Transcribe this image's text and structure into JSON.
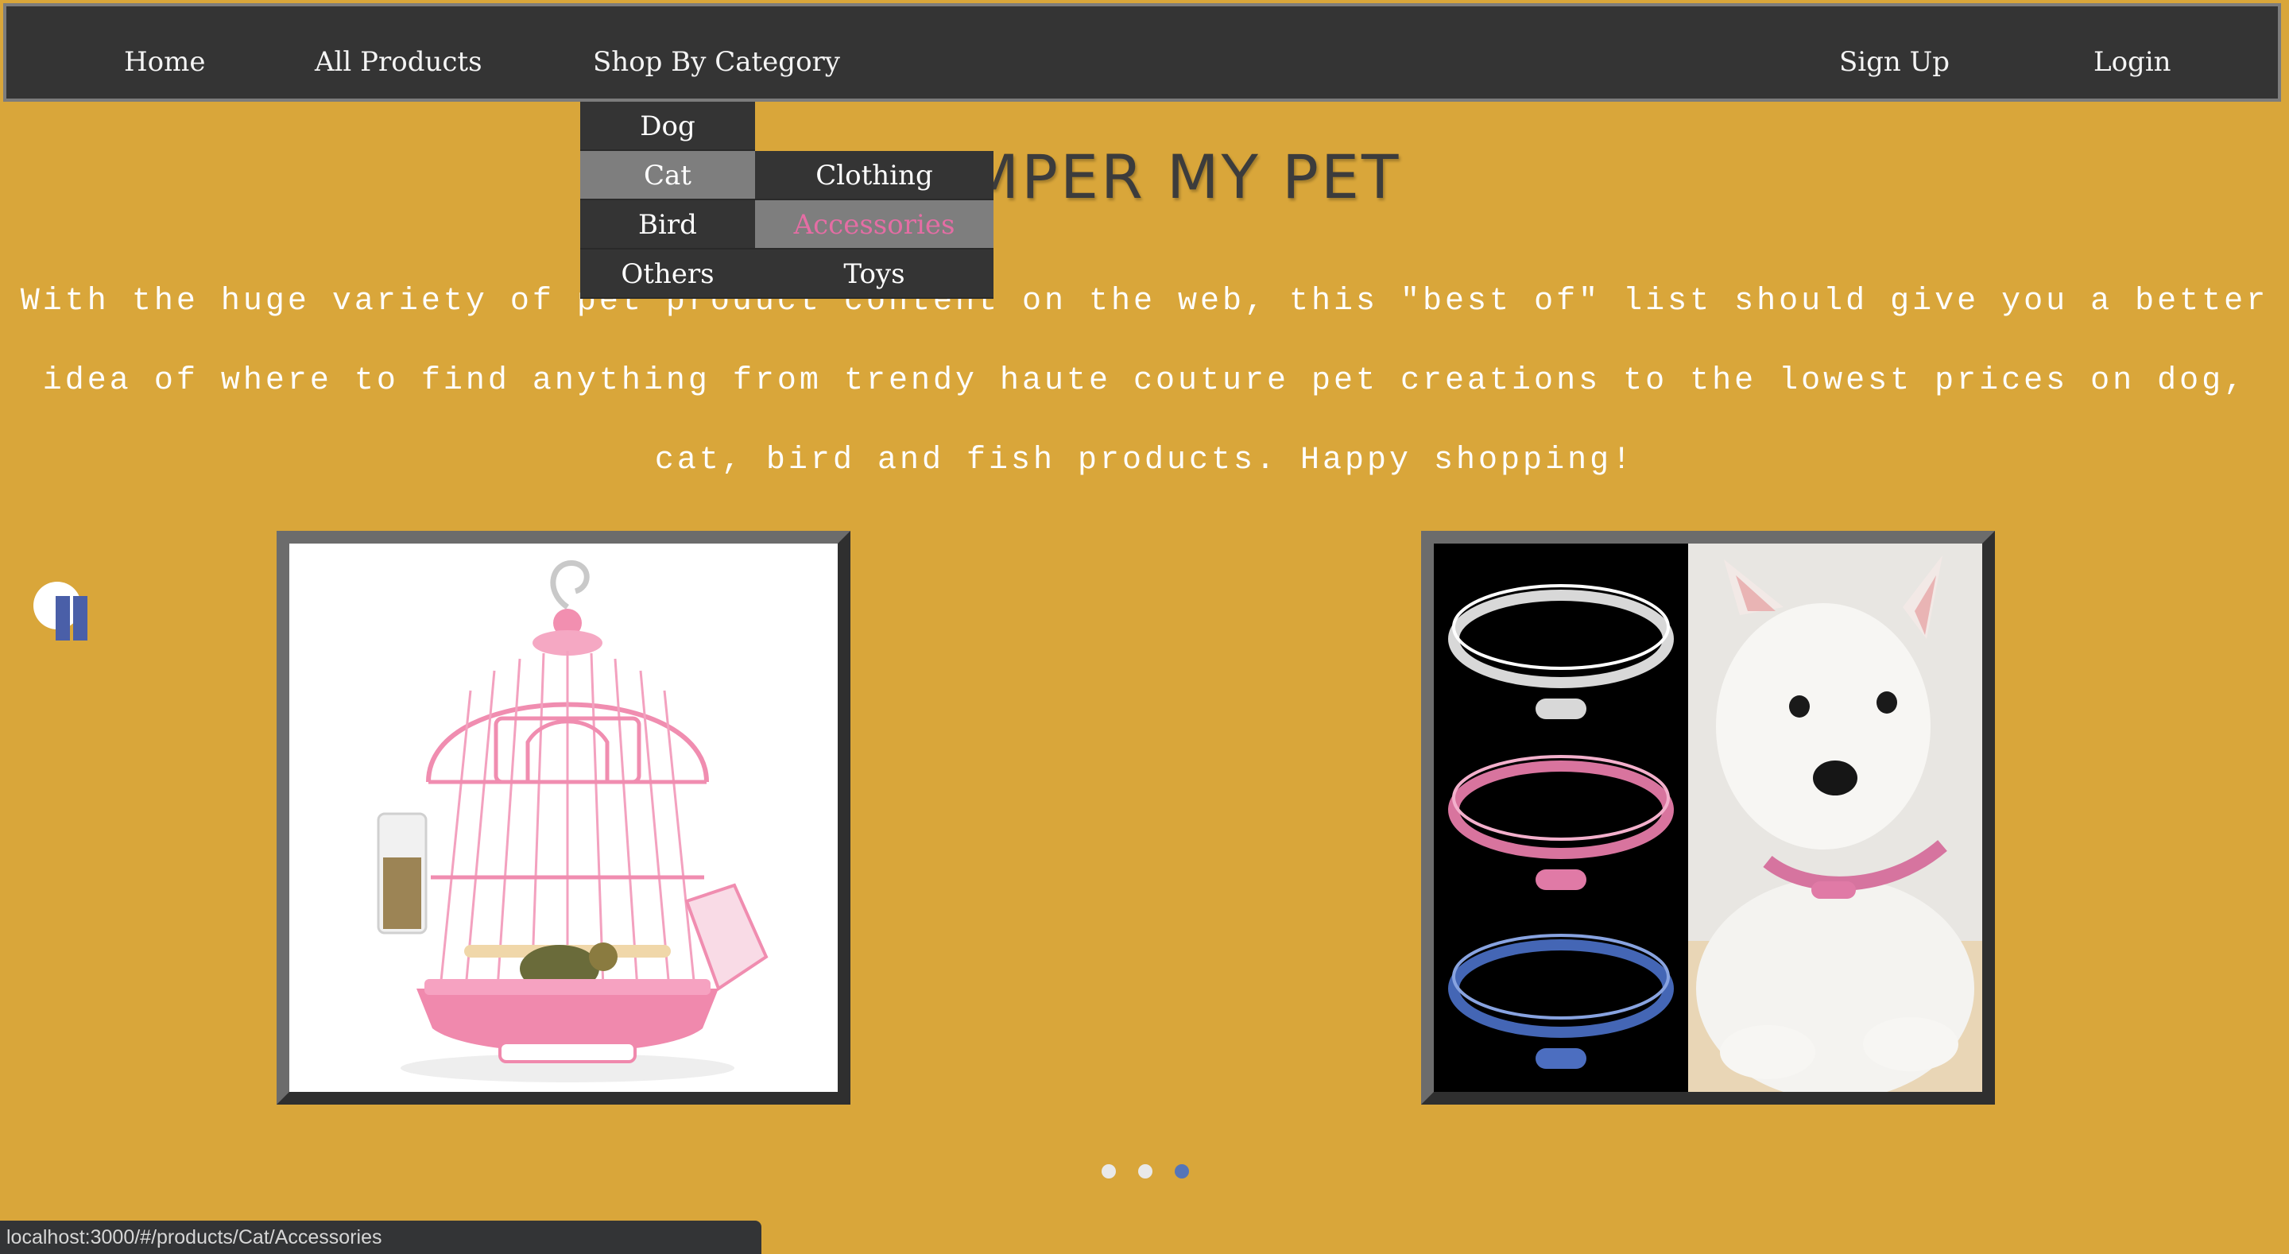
{
  "nav": {
    "home": "Home",
    "all_products": "All Products",
    "shop_by_category": "Shop By Category",
    "sign_up": "Sign Up",
    "login": "Login"
  },
  "dropdown": {
    "categories": [
      "Dog",
      "Cat",
      "Bird",
      "Others"
    ],
    "active_category": "Cat",
    "subcategories": [
      "Clothing",
      "Accessories",
      "Toys"
    ],
    "active_subcategory": "Accessories"
  },
  "hero": {
    "title": "PAMPER MY PET",
    "intro": "With the huge variety of pet product content on the web, this \"best of\" list should give you a better idea of where to find anything from trendy haute couture pet creations to the lowest prices on dog, cat, bird and fish products. Happy shopping!"
  },
  "carousel": {
    "items": [
      {
        "image": "pink-birdcage-image"
      },
      {
        "image": "rhinestone-collars-dog-image"
      }
    ],
    "dots": 3,
    "active_dot": 3
  },
  "status_bar": {
    "url": "localhost:3000/#/products/Cat/Accessories"
  },
  "colors": {
    "background": "#D9A63A",
    "navbar": "#343434",
    "active_menu": "#7e7e7e",
    "active_submenu_text": "#e46da4",
    "active_dot": "#5575b8"
  }
}
